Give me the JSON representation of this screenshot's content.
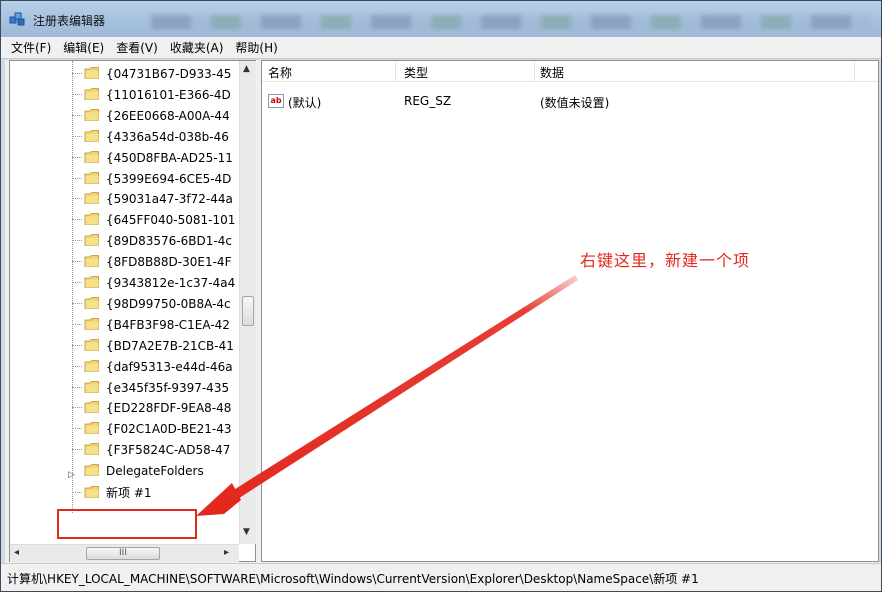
{
  "window": {
    "title": "注册表编辑器"
  },
  "menu": [
    "文件(F)",
    "编辑(E)",
    "查看(V)",
    "收藏夹(A)",
    "帮助(H)"
  ],
  "tree": {
    "items": [
      "{04731B67-D933-45",
      "{11016101-E366-4D",
      "{26EE0668-A00A-44",
      "{4336a54d-038b-46",
      "{450D8FBA-AD25-11",
      "{5399E694-6CE5-4D",
      "{59031a47-3f72-44a",
      "{645FF040-5081-101",
      "{89D83576-6BD1-4c",
      "{8FD8B88D-30E1-4F",
      "{9343812e-1c37-4a4",
      "{98D99750-0B8A-4c",
      "{B4FB3F98-C1EA-42",
      "{BD7A2E7B-21CB-41",
      "{daf95313-e44d-46a",
      "{e345f35f-9397-435",
      "{ED228FDF-9EA8-48",
      "{F02C1A0D-BE21-43",
      "{F3F5824C-AD58-47"
    ],
    "parent_item": "DelegateFolders",
    "new_item": "新项 #1",
    "hscroll_grip": "III"
  },
  "list": {
    "columns": [
      "名称",
      "类型",
      "数据"
    ],
    "rows": [
      {
        "name": "(默认)",
        "type": "REG_SZ",
        "data": "(数值未设置)",
        "icon": "string-value-icon"
      }
    ]
  },
  "annotation": {
    "text": "右键这里，新建一个项",
    "color": "#e3281e"
  },
  "status": {
    "path": "计算机\\HKEY_LOCAL_MACHINE\\SOFTWARE\\Microsoft\\Windows\\CurrentVersion\\Explorer\\Desktop\\NameSpace\\新项 #1"
  }
}
